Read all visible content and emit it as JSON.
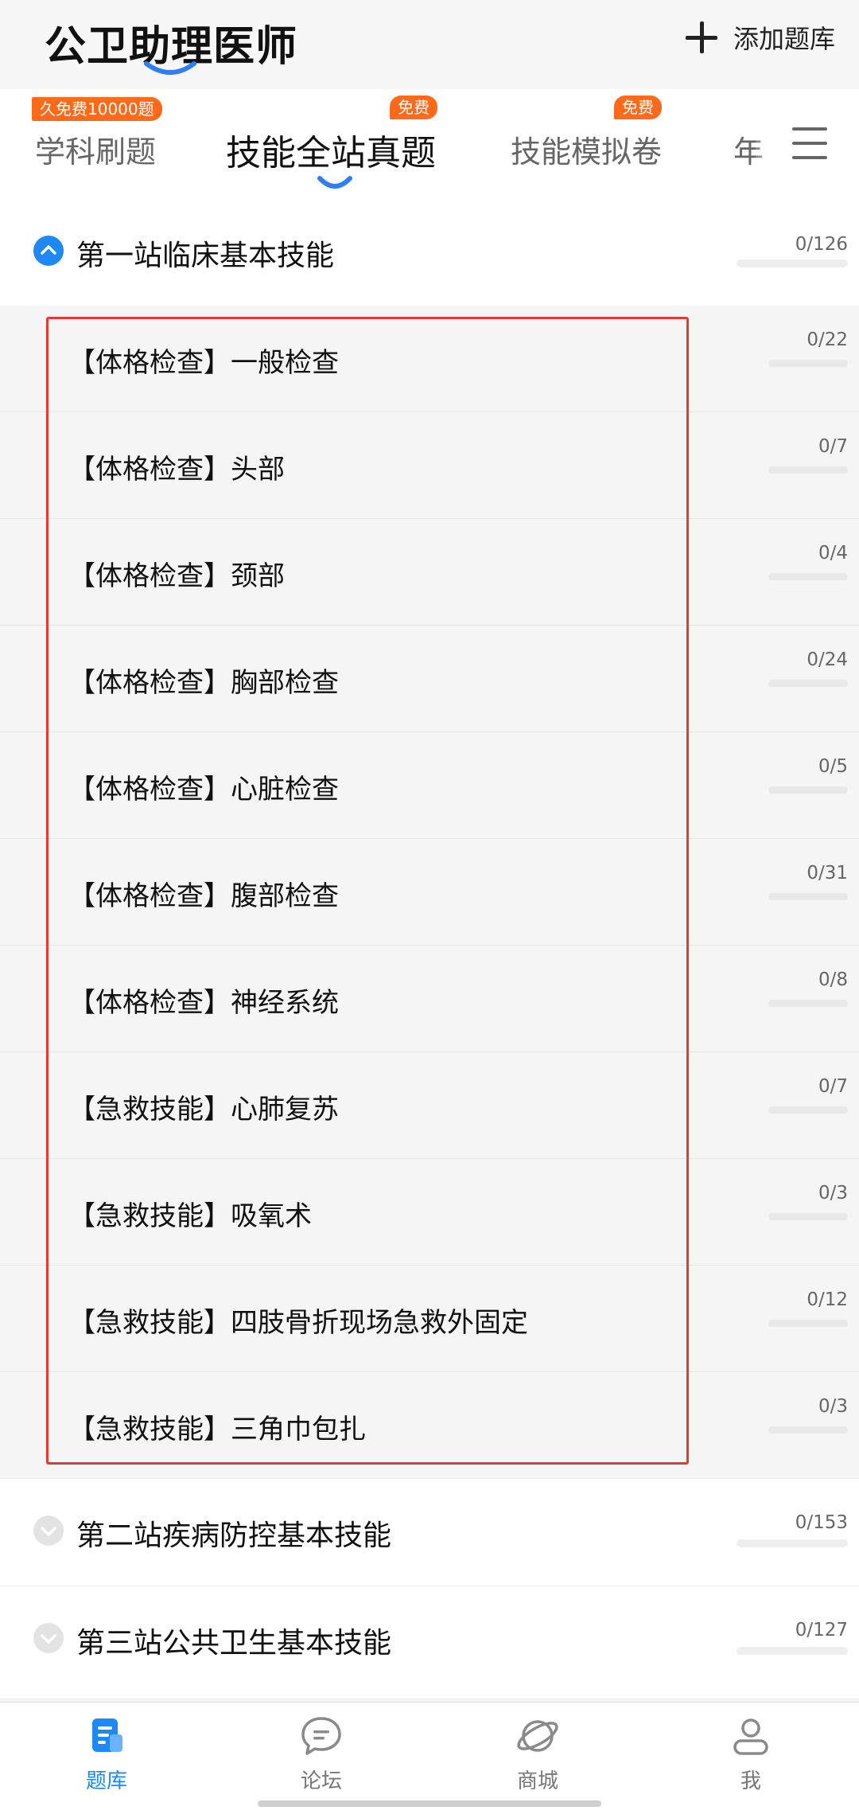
{
  "header": {
    "title": "公卫助理医师",
    "add_label": "添加题库"
  },
  "tabs": [
    {
      "label": "学科刷题",
      "badge": "久免费10000题"
    },
    {
      "label": "技能全站真题",
      "badge": "免费"
    },
    {
      "label": "技能模拟卷",
      "badge": "免费"
    },
    {
      "label": "年",
      "badge": ""
    }
  ],
  "sections": [
    {
      "title": "第一站临床基本技能",
      "progress": "0/126",
      "expanded": true
    },
    {
      "title": "第二站疾病防控基本技能",
      "progress": "0/153",
      "expanded": false
    },
    {
      "title": "第三站公共卫生基本技能",
      "progress": "0/127",
      "expanded": false
    }
  ],
  "items": [
    {
      "title": "【体格检查】一般检查",
      "progress": "0/22"
    },
    {
      "title": "【体格检查】头部",
      "progress": "0/7"
    },
    {
      "title": "【体格检查】颈部",
      "progress": "0/4"
    },
    {
      "title": "【体格检查】胸部检查",
      "progress": "0/24"
    },
    {
      "title": "【体格检查】心脏检查",
      "progress": "0/5"
    },
    {
      "title": "【体格检查】腹部检查",
      "progress": "0/31"
    },
    {
      "title": "【体格检查】神经系统",
      "progress": "0/8"
    },
    {
      "title": "【急救技能】心肺复苏",
      "progress": "0/7"
    },
    {
      "title": "【急救技能】吸氧术",
      "progress": "0/3"
    },
    {
      "title": "【急救技能】四肢骨折现场急救外固定",
      "progress": "0/12"
    },
    {
      "title": "【急救技能】三角巾包扎",
      "progress": "0/3"
    }
  ],
  "nav": [
    {
      "label": "题库",
      "icon": "question-bank-icon",
      "active": true
    },
    {
      "label": "论坛",
      "icon": "forum-icon",
      "active": false
    },
    {
      "label": "商城",
      "icon": "mall-icon",
      "active": false
    },
    {
      "label": "我",
      "icon": "profile-icon",
      "active": false
    }
  ],
  "colors": {
    "accent": "#1e88f5",
    "badge": "#ff6a1a",
    "highlight": "#e53935"
  }
}
